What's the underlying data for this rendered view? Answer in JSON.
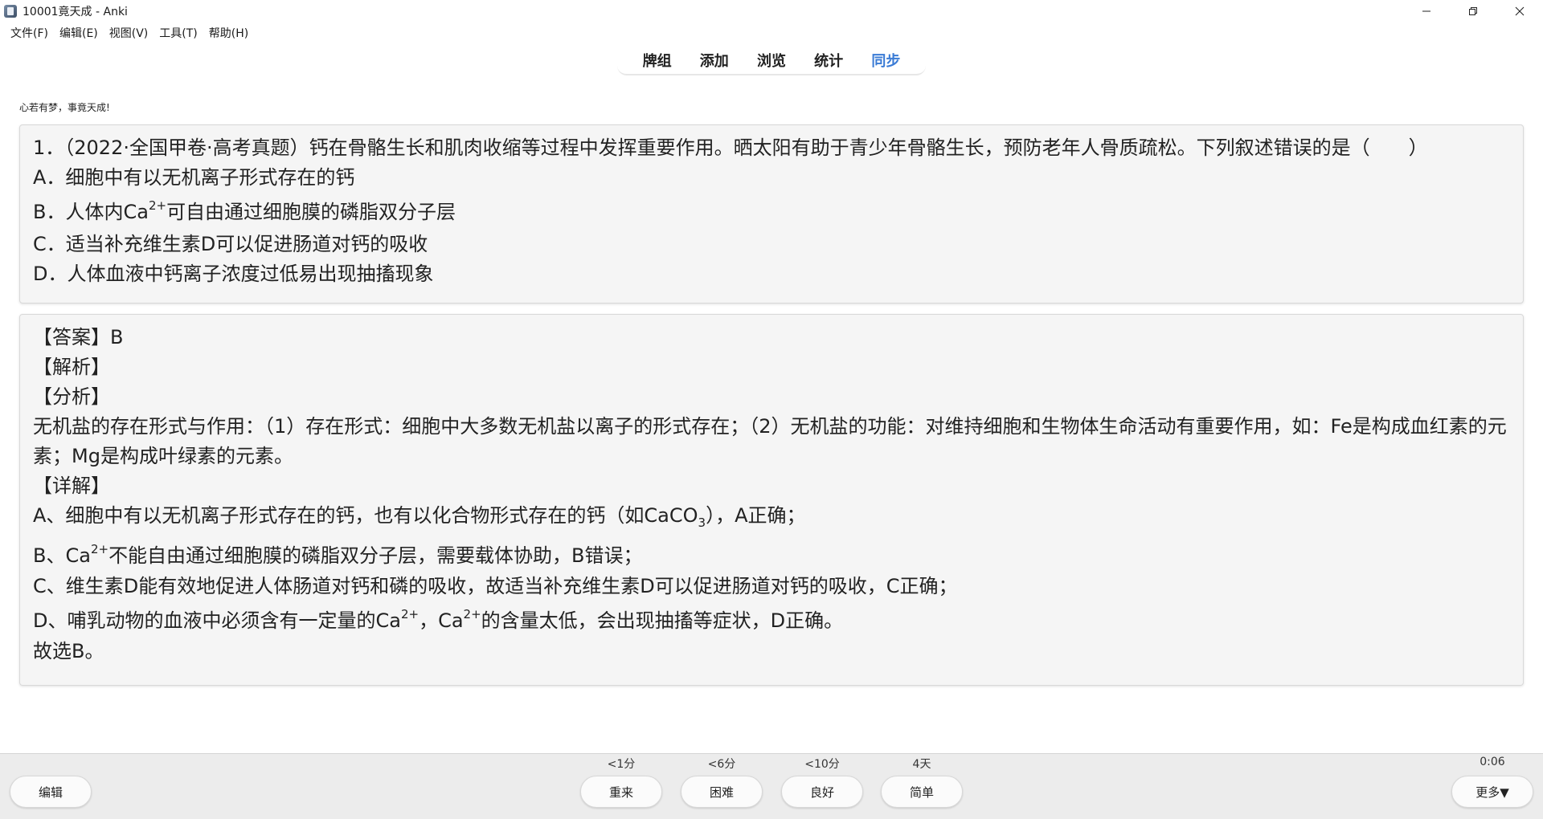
{
  "window": {
    "title": "10001竟天成 - Anki",
    "controls": [
      "minimize",
      "restore",
      "close"
    ]
  },
  "menu": [
    "文件(F)",
    "编辑(E)",
    "视图(V)",
    "工具(T)",
    "帮助(H)"
  ],
  "topnav": {
    "items": [
      "牌组",
      "添加",
      "浏览",
      "统计",
      "同步"
    ],
    "active_index": 4,
    "active_color": "#3a7bd5"
  },
  "deck_motto": "心若有梦，事竟天成!",
  "question": {
    "stem": "1．（2022·全国甲卷·高考真题）钙在骨骼生长和肌肉收缩等过程中发挥重要作用。晒太阳有助于青少年骨骼生长，预防老年人骨质疏松。下列叙述错误的是（　　）",
    "option_a": "A．细胞中有以无机离子形式存在的钙",
    "option_b_pre": "B．人体内Ca",
    "option_b_sup": "2+",
    "option_b_post": "可自由通过细胞膜的磷脂双分子层",
    "option_c": "C．适当补充维生素D可以促进肠道对钙的吸收",
    "option_d": "D．人体血液中钙离子浓度过低易出现抽搐现象"
  },
  "answer": {
    "answer_line": "【答案】B",
    "analysis_heading": "【解析】",
    "fenxi_heading": "【分析】",
    "fenxi_text": "无机盐的存在形式与作用：（1）存在形式：细胞中大多数无机盐以离子的形式存在；（2）无机盐的功能：对维持细胞和生物体生命活动有重要作用，如：Fe是构成血红素的元素；Mg是构成叶绿素的元素。",
    "detail_heading": "【详解】",
    "line_a_pre": "A、细胞中有以无机离子形式存在的钙，也有以化合物形式存在的钙（如CaCO",
    "line_a_sub": "3",
    "line_a_post": "），A正确；",
    "line_b_pre": "B、Ca",
    "line_b_sup": "2+",
    "line_b_post": "不能自由通过细胞膜的磷脂双分子层，需要载体协助，B错误；",
    "line_c": "C、维生素D能有效地促进人体肠道对钙和磷的吸收，故适当补充维生素D可以促进肠道对钙的吸收，C正确；",
    "line_d_pre": "D、哺乳动物的血液中必须含有一定量的Ca",
    "line_d_sup1": "2+",
    "line_d_mid": "，Ca",
    "line_d_sup2": "2+",
    "line_d_post": "的含量太低，会出现抽搐等症状，D正确。",
    "conclusion": "故选B。"
  },
  "bottom": {
    "edit_label": "编辑",
    "timer": "0:06",
    "more_label": "更多▼",
    "ease_buttons": [
      {
        "label": "重来",
        "interval": "<1分"
      },
      {
        "label": "困难",
        "interval": "<6分"
      },
      {
        "label": "良好",
        "interval": "<10分"
      },
      {
        "label": "简单",
        "interval": "4天"
      }
    ]
  }
}
